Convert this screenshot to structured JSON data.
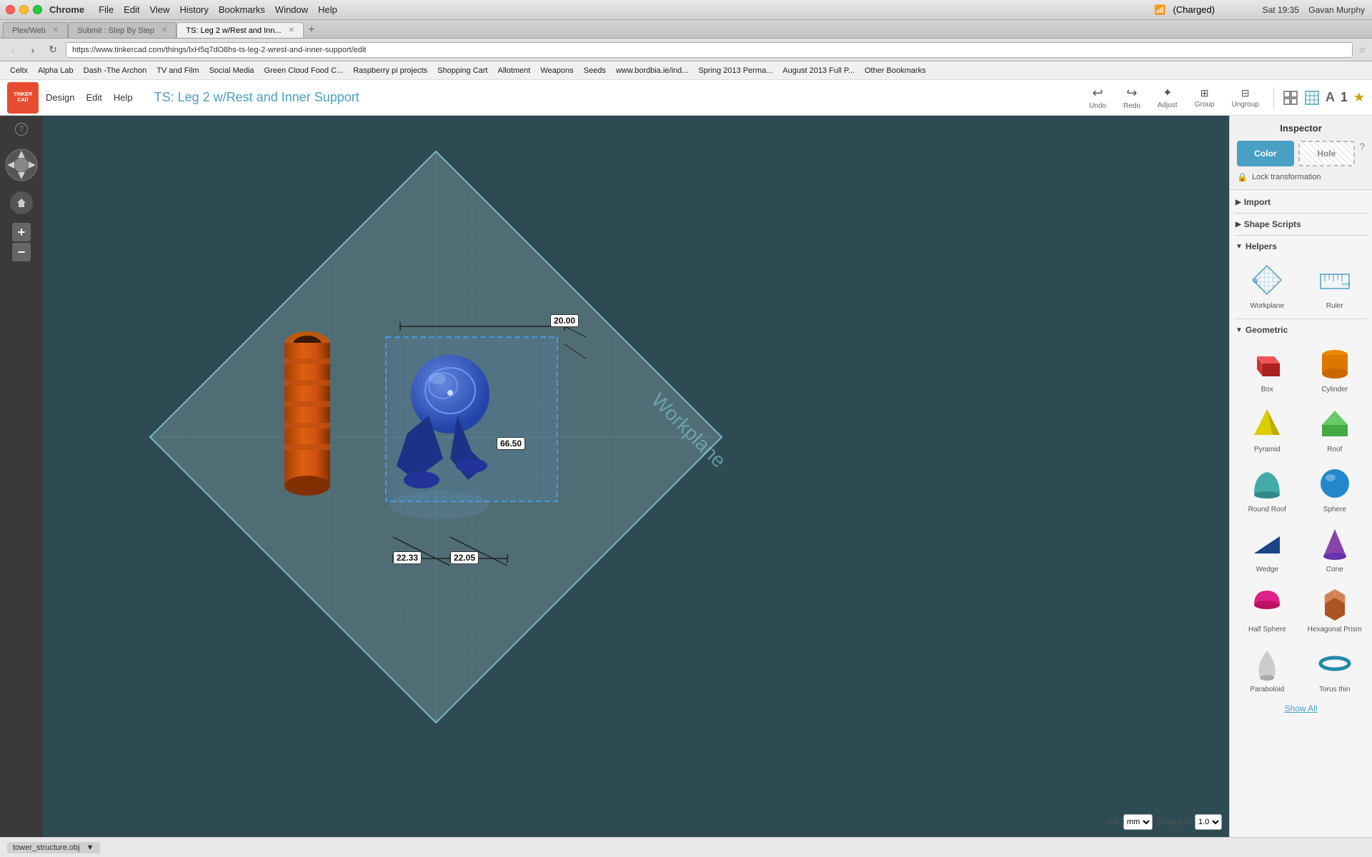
{
  "titlebar": {
    "app_name": "Chrome",
    "menus": [
      "Chrome",
      "File",
      "Edit",
      "View",
      "History",
      "Bookmarks",
      "Window",
      "Help"
    ],
    "clock": "Sat 19:35",
    "user": "Gavan Murphy"
  },
  "tabs": [
    {
      "label": "Plex/Web",
      "active": false,
      "url": "https://plex.tv"
    },
    {
      "label": "Submit : Step By Step",
      "active": false,
      "url": ""
    },
    {
      "label": "TS: Leg 2 w/Rest and Inn...",
      "active": true,
      "url": "https://www.tinkercad.com/things/lxH5q7dO8hs-ts-leg-2-wrest-and-inner-support/edit"
    }
  ],
  "address": "https://www.tinkercad.com/things/lxH5q7dO8hs-ts-leg-2-wrest-and-inner-support/edit",
  "bookmarks": [
    "Celtx",
    "Alpha Lab",
    "Dash -The Archon",
    "TV and Film",
    "Social Media",
    "Green Cloud Food C...",
    "Raspberry pi projects",
    "Shopping Cart",
    "Allotment",
    "Weapons",
    "Seeds",
    "www.bordbia.ie/ind...",
    "Spring 2013 Perma...",
    "August 2013 Full P...",
    "Other Bookmarks"
  ],
  "app": {
    "logo_lines": [
      "TINKER",
      "CAD"
    ],
    "nav_items": [
      "Design",
      "Edit",
      "Help"
    ],
    "title": "TS: Leg 2 w/Rest and Inner Support",
    "toolbar": {
      "undo": "Undo",
      "redo": "Redo",
      "adjust": "Adjust",
      "group": "Group",
      "ungroup": "Ungroup"
    }
  },
  "right_panel": {
    "import_label": "Import",
    "shape_scripts_label": "Shape Scripts",
    "helpers_label": "Helpers",
    "geometric_label": "Geometric",
    "workplane_label": "Workplane",
    "ruler_label": "Ruler",
    "inspector": {
      "title": "Inspector",
      "color_label": "Color",
      "hole_label": "Hole",
      "lock_label": "Lock transformation"
    },
    "shapes": [
      {
        "name": "Box",
        "color": "#cc3333"
      },
      {
        "name": "Cylinder",
        "color": "#cc8800"
      },
      {
        "name": "Pyramid",
        "color": "#ddcc00"
      },
      {
        "name": "Roof",
        "color": "#44aa44"
      },
      {
        "name": "Round Roof",
        "color": "#44aaaa"
      },
      {
        "name": "Sphere",
        "color": "#2288cc"
      },
      {
        "name": "Wedge",
        "color": "#2255aa"
      },
      {
        "name": "Cone",
        "color": "#8844aa"
      },
      {
        "name": "Half Sphere",
        "color": "#dd2288"
      },
      {
        "name": "Hexagonal Prism",
        "color": "#cc7744"
      },
      {
        "name": "Paraboloid",
        "color": "#aaaaaa"
      },
      {
        "name": "Torus thin",
        "color": "#2288aa"
      }
    ],
    "show_all_label": "Show All",
    "unit_label": "Unit",
    "unit_value": "mm",
    "snap_grid_label": "Snap grid",
    "snap_grid_value": "1.0"
  },
  "canvas": {
    "dimension1": "20.00",
    "dimension2": "66.50",
    "dimension3": "22.33",
    "dimension4": "22.05",
    "workplane_text": "Workplane"
  },
  "statusbar": {
    "filename": "tower_structure.obj"
  }
}
